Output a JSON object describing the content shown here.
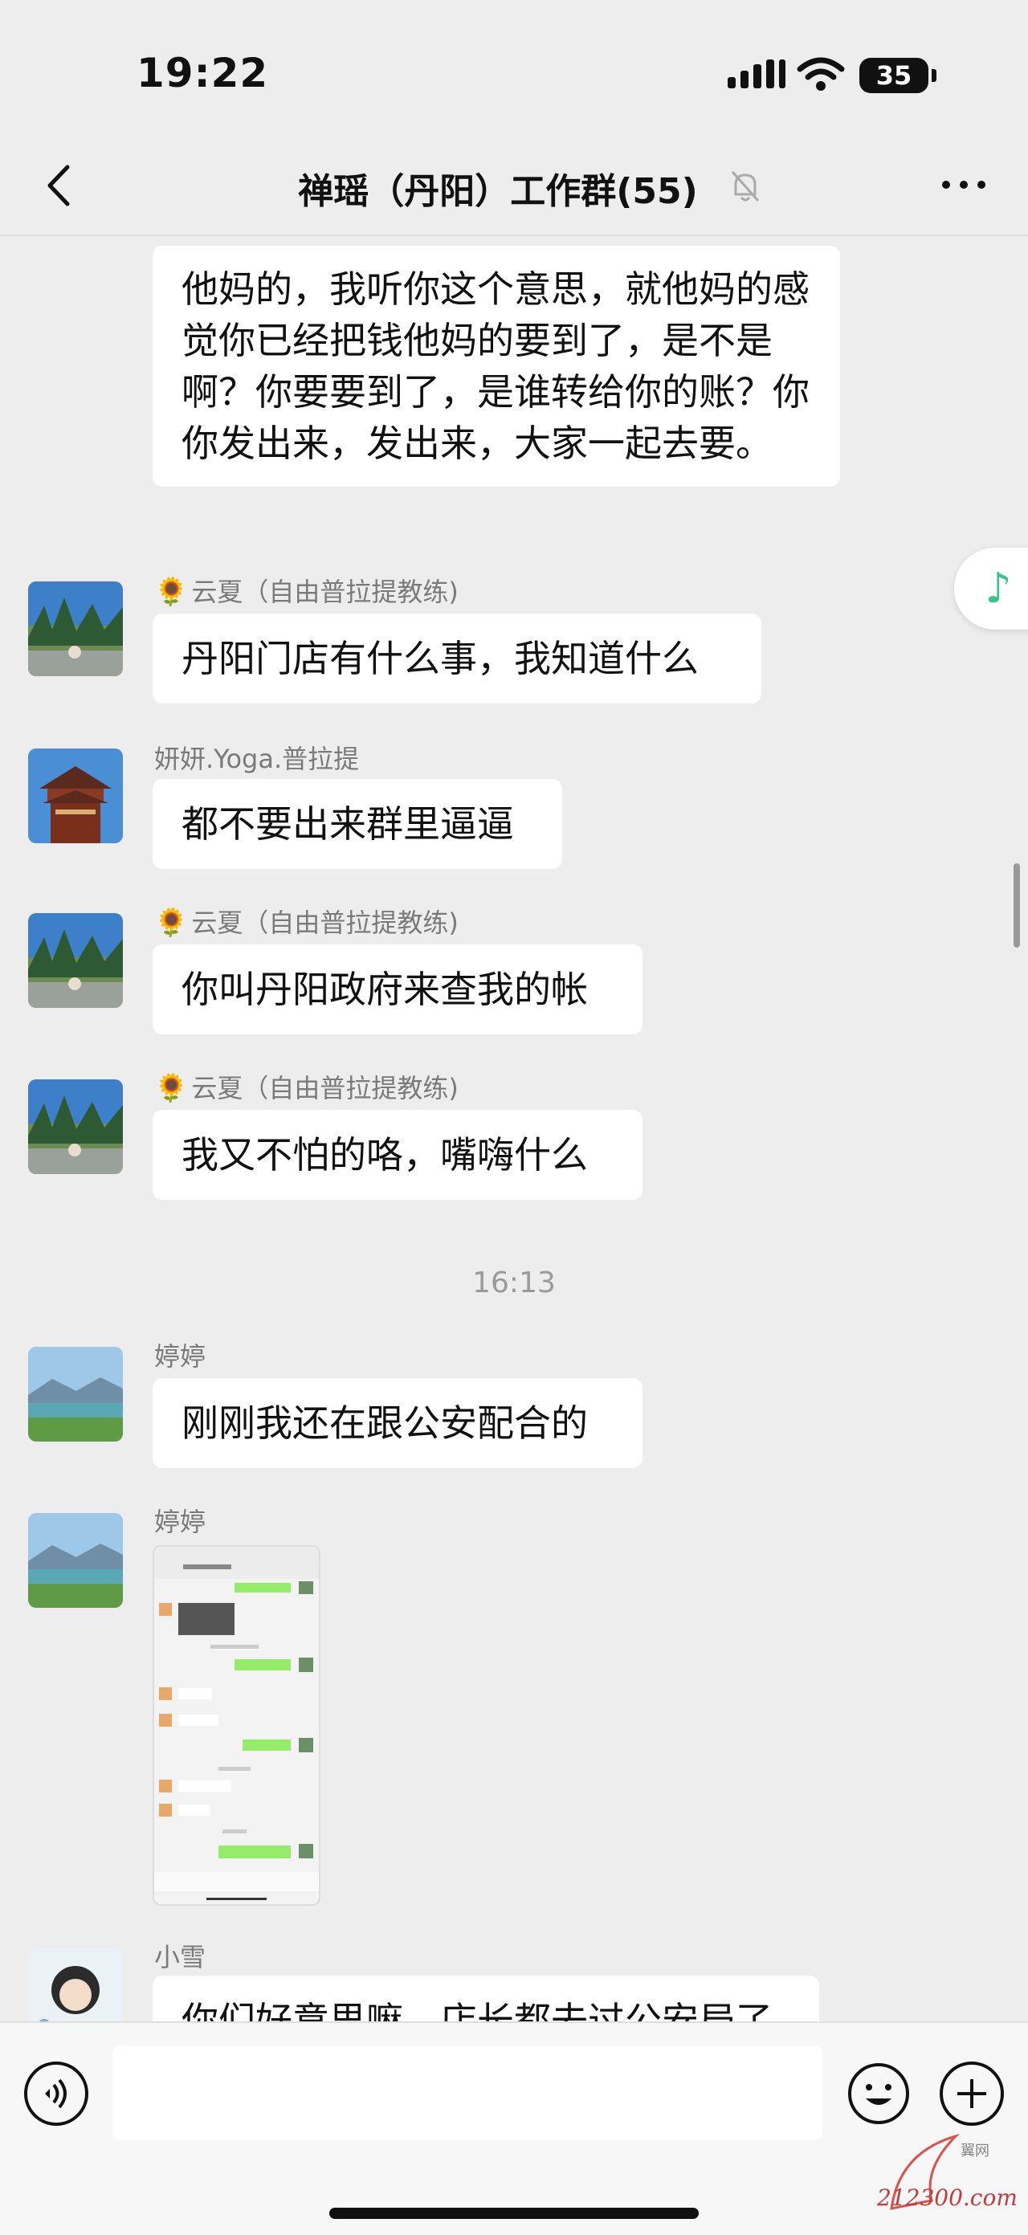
{
  "status_bar": {
    "time": "19:22",
    "battery": "35"
  },
  "nav": {
    "title": "禅瑶（丹阳）工作群(55)"
  },
  "messages": [
    {
      "text": "他妈的，我听你这个意思，就他妈的感觉你已经把钱他妈的要到了，是不是啊？你要要到了，是谁转给你的账？你你发出来，发出来，大家一起去要。"
    },
    {
      "sender": "云夏（自由普拉提教练)",
      "text": "丹阳门店有什么事，我知道什么"
    },
    {
      "sender": "妍妍.Yoga.普拉提",
      "text": "都不要出来群里逼逼"
    },
    {
      "sender": "云夏（自由普拉提教练)",
      "text": "你叫丹阳政府来查我的帐"
    },
    {
      "sender": "云夏（自由普拉提教练)",
      "text": "我又不怕的咯，嘴嗨什么"
    },
    {
      "time": "16:13"
    },
    {
      "sender": "婷婷",
      "text": "刚刚我还在跟公安配合的"
    },
    {
      "sender": "婷婷"
    },
    {
      "sender": "小雪",
      "text": "你们好意思嘛，店长都去过公安局了"
    }
  ],
  "watermark": {
    "text": "212300.com",
    "top": "翼网"
  },
  "colors": {
    "background": "#ededed",
    "bubble": "#ffffff",
    "accent_green": "#35c58a",
    "watermark_red": "#c53a3a"
  },
  "icons": [
    "back-icon",
    "mute-bell-icon",
    "more-icon",
    "music-note-icon",
    "sunflower-icon",
    "voice-icon",
    "emoji-icon",
    "plus-icon"
  ]
}
